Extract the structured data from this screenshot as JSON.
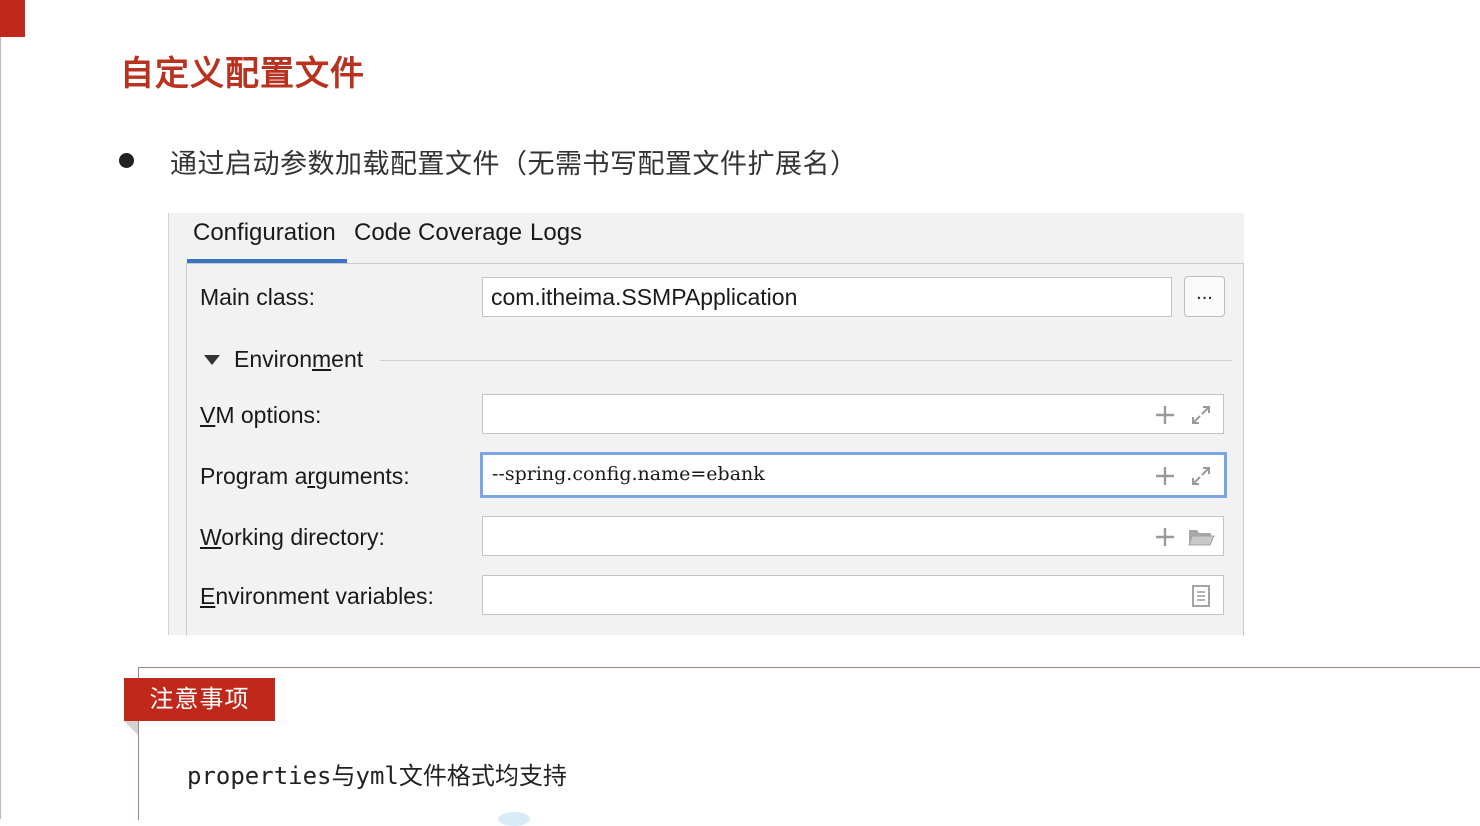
{
  "slide": {
    "title": "自定义配置文件",
    "bullet": "通过启动参数加载配置文件（无需书写配置文件扩展名）"
  },
  "ide": {
    "tabs": [
      {
        "label": "Configuration",
        "active": true
      },
      {
        "label": "Code Coverage",
        "active": false
      },
      {
        "label": "Logs",
        "active": false
      }
    ],
    "main_class": {
      "label": "Main class:",
      "value": "com.itheima.SSMPApplication",
      "browse_label": "..."
    },
    "environment": {
      "label_pre": "Environ",
      "label_u": "m",
      "label_post": "ent",
      "expanded": true
    },
    "vm_options": {
      "label_u": "V",
      "label_rest": "M options:",
      "value": ""
    },
    "program_arguments": {
      "label_pre": "Program a",
      "label_u": "r",
      "label_post": "guments:",
      "value": "--spring.config.name=ebank"
    },
    "working_directory": {
      "label_u": "W",
      "label_rest": "orking directory:",
      "value": ""
    },
    "environment_variables": {
      "label_u": "E",
      "label_rest": "nvironment variables:",
      "value": ""
    }
  },
  "notice": {
    "badge": "注意事项",
    "text_code": "properties",
    "text_cjk1": "与",
    "text_code2": "yml",
    "text_cjk2": "文件格式均支持"
  },
  "colors": {
    "accent_red": "#c0281c",
    "title_red": "#b8321f",
    "tab_underline_blue": "#3a74c4",
    "focus_blue": "#7aa6e3"
  }
}
